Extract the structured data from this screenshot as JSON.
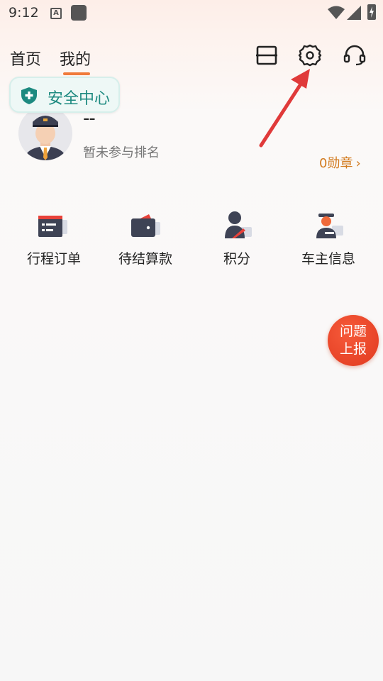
{
  "status_bar": {
    "time": "9:12",
    "icons": [
      "a-icon",
      "app-square-icon",
      "wifi-icon",
      "signal-icon",
      "battery-charging-icon"
    ]
  },
  "tabs": [
    {
      "label": "首页",
      "active": false
    },
    {
      "label": "我的",
      "active": true
    }
  ],
  "toolbar_icons": [
    "scan-icon",
    "gear-icon",
    "headset-icon"
  ],
  "safety_center": {
    "label": "安全中心",
    "icon": "shield-plus-icon"
  },
  "profile": {
    "name": "--",
    "rank_text": "暂未参与排名",
    "medal_text": "0勋章"
  },
  "menu": [
    {
      "label": "行程订单",
      "icon": "order-card-icon"
    },
    {
      "label": "待结算款",
      "icon": "wallet-icon"
    },
    {
      "label": "积分",
      "icon": "user-points-icon"
    },
    {
      "label": "车主信息",
      "icon": "driver-id-icon"
    }
  ],
  "report_button": {
    "line1": "问题",
    "line2": "上报"
  },
  "colors": {
    "accent": "#f07a3a",
    "safety_green": "#1d8a80",
    "medal": "#d27a1e",
    "report_red": "#e13a1f",
    "annotation_arrow": "#e03a3a"
  }
}
